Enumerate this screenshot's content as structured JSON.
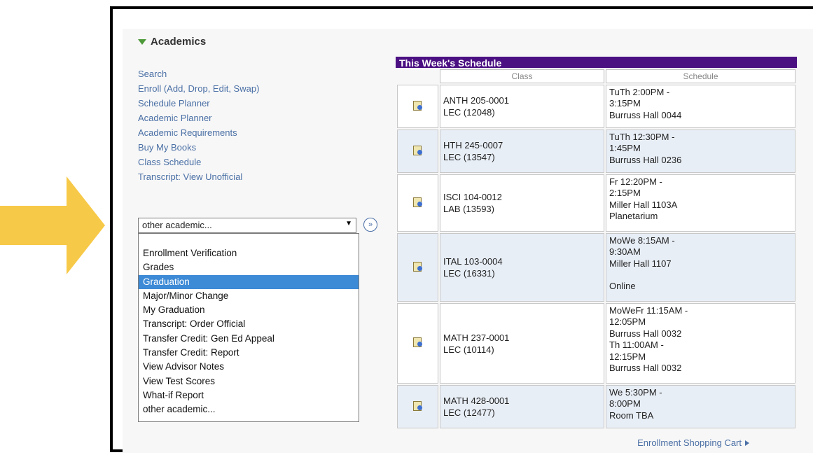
{
  "colors": {
    "arrow": "#f7c948",
    "schedule_header": "#4b1082",
    "link": "#4a6fa5",
    "selected": "#3d8ad6"
  },
  "academics": {
    "title": "Academics",
    "links": [
      "Search",
      "Enroll (Add, Drop, Edit, Swap)",
      "Schedule Planner",
      "Academic Planner",
      "Academic Requirements",
      "Buy My Books",
      "Class Schedule",
      "Transcript: View Unofficial"
    ],
    "select_value": "other academic...",
    "dropdown_options": [
      "Enrollment Verification",
      "Grades",
      "Graduation",
      "Major/Minor Change",
      "My Graduation",
      "Transcript: Order Official",
      "Transfer Credit: Gen Ed Appeal",
      "Transfer Credit: Report",
      "View Advisor Notes",
      "View Test Scores",
      "What-if Report",
      "other academic..."
    ],
    "selected_option": "Graduation"
  },
  "schedule": {
    "title": "This Week's Schedule",
    "col_class": "Class",
    "col_schedule": "Schedule",
    "rows": [
      {
        "course": "ANTH 205-0001",
        "section": "LEC (12048)",
        "lines": [
          "TuTh 2:00PM -",
          "3:15PM",
          "Burruss Hall 0044"
        ]
      },
      {
        "course": "HTH 245-0007",
        "section": "LEC (13547)",
        "lines": [
          "TuTh 12:30PM -",
          "1:45PM",
          "Burruss Hall 0236"
        ]
      },
      {
        "course": "ISCI 104-0012",
        "section": "LAB (13593)",
        "lines": [
          "Fr 12:20PM -",
          "2:15PM",
          "Miller Hall 1103A",
          "Planetarium"
        ]
      },
      {
        "course": "ITAL 103-0004",
        "section": "LEC (16331)",
        "lines": [
          "MoWe 8:15AM -",
          "9:30AM",
          "Miller Hall 1107",
          "",
          "Online"
        ]
      },
      {
        "course": "MATH 237-0001",
        "section": "LEC (10114)",
        "lines": [
          "MoWeFr 11:15AM -",
          "12:05PM",
          "Burruss Hall 0032",
          "Th 11:00AM -",
          "12:15PM",
          "Burruss Hall 0032"
        ]
      },
      {
        "course": "MATH 428-0001",
        "section": "LEC (12477)",
        "lines": [
          "We 5:30PM -",
          "8:00PM",
          "Room  TBA"
        ]
      }
    ]
  },
  "cart_link": "Enrollment Shopping Cart"
}
